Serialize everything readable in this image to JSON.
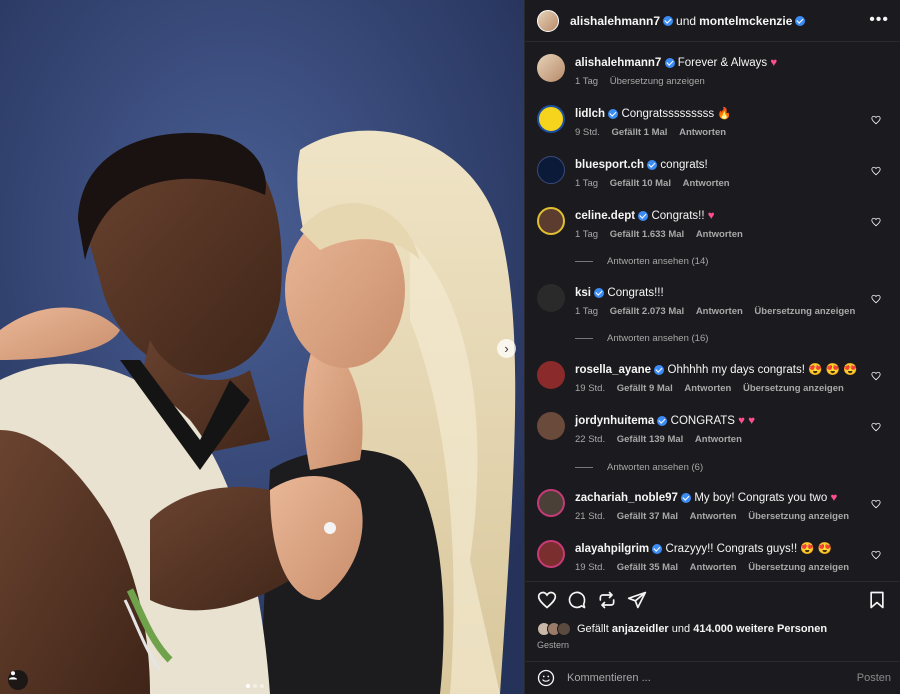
{
  "header": {
    "author": "alishalehmann7",
    "joiner": "und",
    "collaborator": "montelmckenzie",
    "more_icon": "more-horizontal-icon"
  },
  "caption": {
    "username": "alishalehmann7",
    "text": "Forever & Always",
    "emoji": "♥",
    "time": "1 Tag",
    "translate": "Übersetzung anzeigen"
  },
  "comments": [
    {
      "username": "lidlch",
      "text": "Congratsssssssss",
      "emoji": "🔥",
      "time": "9 Std.",
      "likes": "Gefällt 1 Mal",
      "reply": "Antworten",
      "translate": "",
      "avatar_color": "#f6d31d"
    },
    {
      "username": "bluesport.ch",
      "text": "congrats!",
      "emoji": "",
      "time": "1 Tag",
      "likes": "Gefällt 10 Mal",
      "reply": "Antworten",
      "translate": "",
      "avatar_color": "#0c1a3a"
    },
    {
      "username": "celine.dept",
      "text": "Congrats!!",
      "emoji": "♥",
      "time": "1 Tag",
      "likes": "Gefällt 1.633 Mal",
      "reply": "Antworten",
      "translate": "",
      "avatar_color": "#5b3c2f"
    },
    {
      "username": "ksi",
      "text": "Congrats!!!",
      "emoji": "",
      "time": "1 Tag",
      "likes": "Gefällt 2.073 Mal",
      "reply": "Antworten",
      "translate": "Übersetzung anzeigen",
      "avatar_color": "#2a2a2a"
    },
    {
      "username": "rosella_ayane",
      "text": "Ohhhhh my days congrats!",
      "emoji": "😍 😍 😍",
      "time": "19 Std.",
      "likes": "Gefällt 9 Mal",
      "reply": "Antworten",
      "translate": "Übersetzung anzeigen",
      "avatar_color": "#8b2a2a"
    },
    {
      "username": "jordynhuitema",
      "text": "CONGRATS",
      "emoji": "♥ ♥",
      "time": "22 Std.",
      "likes": "Gefällt 139 Mal",
      "reply": "Antworten",
      "translate": "",
      "avatar_color": "#6a4a3a"
    },
    {
      "username": "zachariah_noble97",
      "text": "My boy! Congrats you two",
      "emoji": "♥",
      "time": "21 Std.",
      "likes": "Gefällt 37 Mal",
      "reply": "Antworten",
      "translate": "Übersetzung anzeigen",
      "avatar_color": "#4a4038"
    },
    {
      "username": "alayahpilgrim",
      "text": "Crazyyy!! Congrats guys!!",
      "emoji": "😍 😍",
      "time": "19 Std.",
      "likes": "Gefällt 35 Mal",
      "reply": "Antworten",
      "translate": "Übersetzung anzeigen",
      "avatar_color": "#7a2e2e"
    }
  ],
  "view_replies": [
    "Antworten ansehen (14)",
    "Antworten ansehen (16)",
    "Antworten ansehen (6)"
  ],
  "likes": {
    "prefix": "Gefällt",
    "user": "anjazeidler",
    "middle": "und",
    "count": "414.000 weitere Personen"
  },
  "date": "Gestern",
  "compose": {
    "placeholder": "Kommentieren ...",
    "post_label": "Posten"
  },
  "carousel": {
    "slide_count": 3,
    "active_slide": 1
  },
  "colors": {
    "verified": "#3b8cf5",
    "heart": "#ff4f8b",
    "panel_bg": "#1b1b1f"
  }
}
